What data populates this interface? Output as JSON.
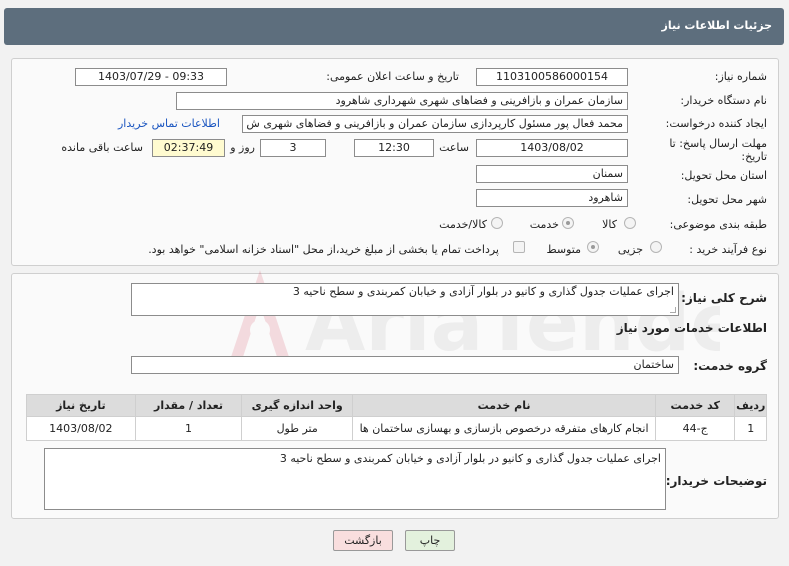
{
  "header": {
    "title": "جزئیات اطلاعات نیاز"
  },
  "details": {
    "need_number_label": "شماره نیاز:",
    "need_number": "1103100586000154",
    "announce_label": "تاریخ و ساعت اعلان عمومی:",
    "announce_value": "1403/07/29 - 09:33",
    "buyer_org_label": "نام دستگاه خریدار:",
    "buyer_org": "سازمان عمران و بازافرینی و فضاهای شهری شهرداری شاهرود",
    "creator_label": "ایجاد کننده درخواست:",
    "creator": "محمد فعال پور مسئول کارپردازی سازمان عمران و بازافرینی و فضاهای شهری ش",
    "contact_link": "اطلاعات تماس خریدار",
    "deadline_label": "مهلت ارسال پاسخ: تا تاریخ:",
    "deadline_date": "1403/08/02",
    "time_label": "ساعت",
    "deadline_time": "12:30",
    "days_value": "3",
    "days_label": "روز و",
    "remaining_time": "02:37:49",
    "remaining_label": "ساعت باقی مانده",
    "province_label": "استان محل تحویل:",
    "province": "سمنان",
    "city_label": "شهر محل تحویل:",
    "city": "شاهرود",
    "category_label": "طبقه بندی موضوعی:",
    "category_options": [
      "کالا",
      "خدمت",
      "کالا/خدمت"
    ],
    "category_selected": "خدمت",
    "process_label": "نوع فرآیند خرید :",
    "process_options": [
      "جزیی",
      "متوسط"
    ],
    "process_selected": "متوسط",
    "payment_note": "پرداخت تمام یا بخشی از مبلغ خرید،از محل \"اسناد خزانه اسلامی\" خواهد بود."
  },
  "summary": {
    "label": "شرح کلی نیاز:",
    "value": "اجرای عملیات جدول گذاری و کانیو در بلوار آزادی و خیابان کمربندی و سطح ناحیه 3"
  },
  "services": {
    "section_title": "اطلاعات خدمات مورد نیاز",
    "group_label": "گروه خدمت:",
    "group_value": "ساختمان",
    "columns": [
      "ردیف",
      "کد خدمت",
      "نام خدمت",
      "واحد اندازه گیری",
      "تعداد / مقدار",
      "تاریخ نیاز"
    ],
    "rows": [
      [
        "1",
        "ج-44",
        "انجام کارهای متفرقه درخصوص بازسازی و بهسازی ساختمان ها",
        "متر طول",
        "1",
        "1403/08/02"
      ]
    ]
  },
  "buyer_notes": {
    "label": "توضیحات خریدار:",
    "value": "اجرای عملیات جدول گذاری و کانیو در بلوار آزادی و خیابان کمربندی و سطح ناحیه 3"
  },
  "buttons": {
    "print": "چاپ",
    "back": "بازگشت"
  },
  "watermark": {
    "text": "AriaTender.net"
  },
  "colors": {
    "header_bg": "#5d6e7d",
    "link": "#1a55c0",
    "back_btn_bg": "#f9dede",
    "print_btn_bg": "#e3f1dd"
  }
}
